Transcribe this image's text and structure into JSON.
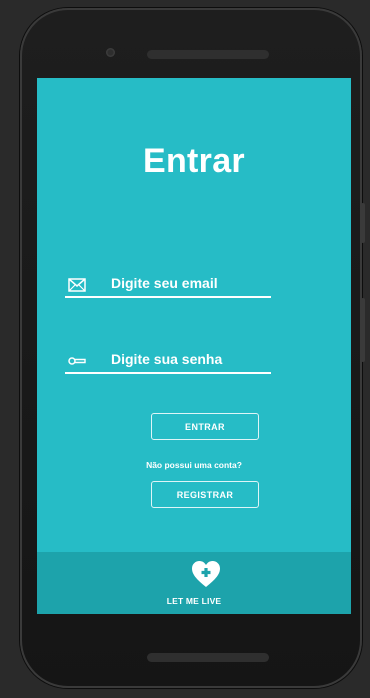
{
  "login": {
    "title": "Entrar",
    "email_placeholder": "Digite seu email",
    "password_placeholder": "Digite sua senha",
    "login_button": "ENTRAR",
    "no_account_text": "Não possui uma conta?",
    "register_button": "REGISTRAR"
  },
  "footer": {
    "brand": "LET ME LIVE",
    "logo_icon": "heart-plus-icon"
  },
  "icons": {
    "email": "envelope-icon",
    "password": "key-icon"
  },
  "colors": {
    "screen_bg": "#26bcc6",
    "footer_bg": "#1da3ab",
    "text": "#ffffff",
    "device": "#1b1b1b"
  }
}
